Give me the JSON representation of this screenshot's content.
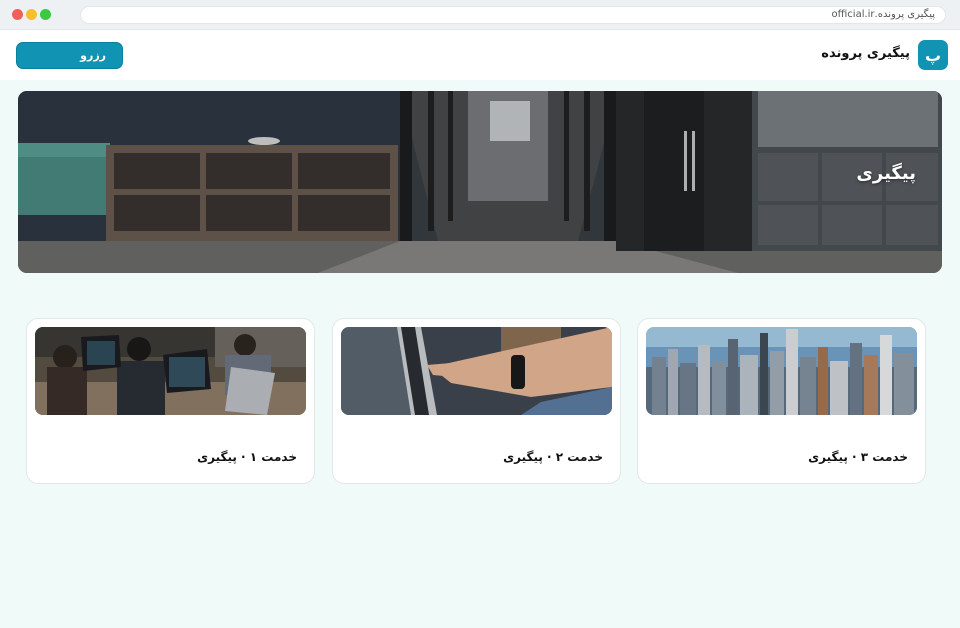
{
  "browser": {
    "url": "پیگیری پرونده.official.ir"
  },
  "header": {
    "logo_letter": "پ",
    "site_name": "پیگیری پرونده",
    "reserve_label": "رزرو"
  },
  "hero": {
    "title": "پیگیری"
  },
  "cards": [
    {
      "title": "خدمت ۱ · پیگیری",
      "image": "team-laptops-photo"
    },
    {
      "title": "خدمت ۲ · پیگیری",
      "image": "hand-touchscreen-photo"
    },
    {
      "title": "خدمت ۳ · پیگیری",
      "image": "city-skyline-photo"
    }
  ],
  "colors": {
    "accent": "#1194b4",
    "page_bg": "#f0fbf9"
  }
}
